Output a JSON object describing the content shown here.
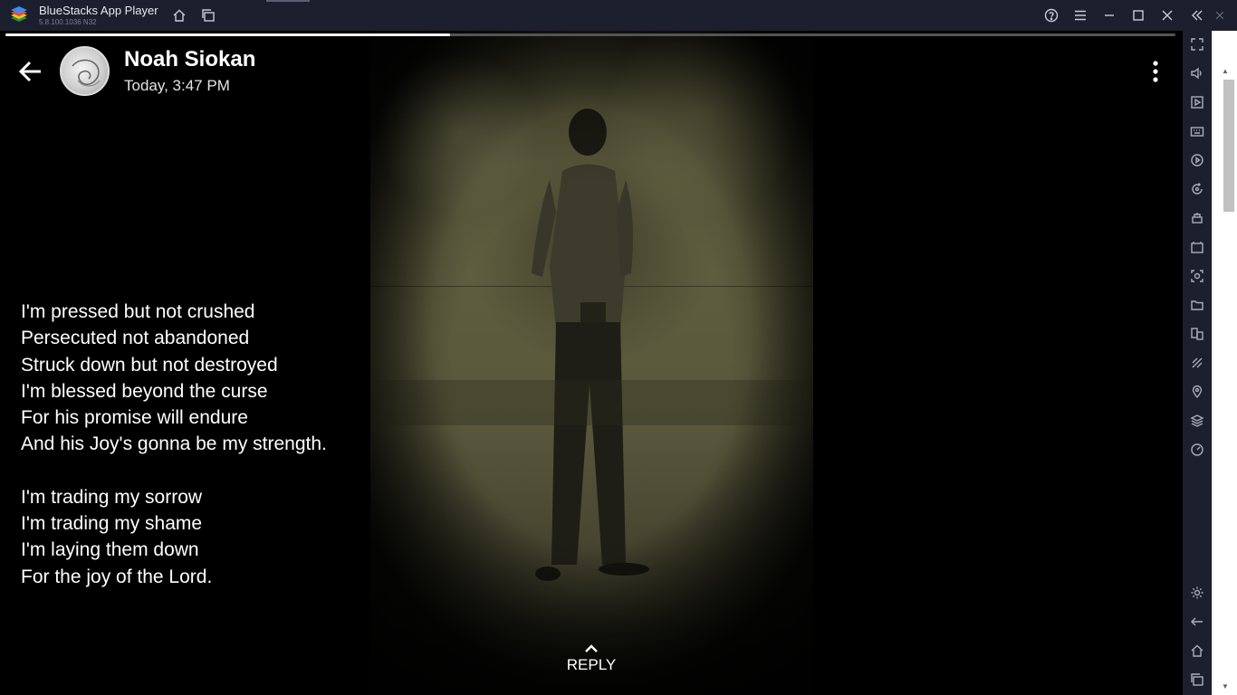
{
  "window": {
    "app_name": "BlueStacks App Player",
    "version": "5.8.100.1036 N32",
    "toolbar_icons": [
      "home-icon",
      "multi-instance-icon",
      "help-icon",
      "menu-icon",
      "minimize-icon",
      "maximize-icon",
      "close-icon",
      "collapse-sidebar-icon"
    ]
  },
  "status": {
    "sender_name": "Noah Siokan",
    "timestamp": "Today, 3:47 PM",
    "progress": 0.38,
    "lyrics": [
      [
        "I'm pressed but not crushed",
        "Persecuted not abandoned",
        "Struck down but not destroyed",
        "I'm blessed beyond the curse",
        "For his promise will endure",
        "And his Joy's gonna be my strength."
      ],
      [
        "I'm trading my sorrow",
        "I'm trading my shame",
        "I'm laying them down",
        "For the joy of the Lord."
      ]
    ],
    "reply_label": "REPLY"
  },
  "sidebar": {
    "icons": [
      "fullscreen-icon",
      "volume-icon",
      "media-icon",
      "keyboard-icon",
      "macro-icon",
      "rotate-icon",
      "game-controls-icon",
      "apk-icon",
      "screenshot-icon",
      "folder-icon",
      "multi-instance-icon",
      "eco-mode-icon",
      "location-icon",
      "layers-icon",
      "performance-icon",
      "settings-icon",
      "back-icon",
      "home-icon",
      "recents-icon"
    ]
  },
  "colors": {
    "chrome_bg": "#1c1f2e",
    "screen_bg": "#000000",
    "text": "#ffffff"
  }
}
